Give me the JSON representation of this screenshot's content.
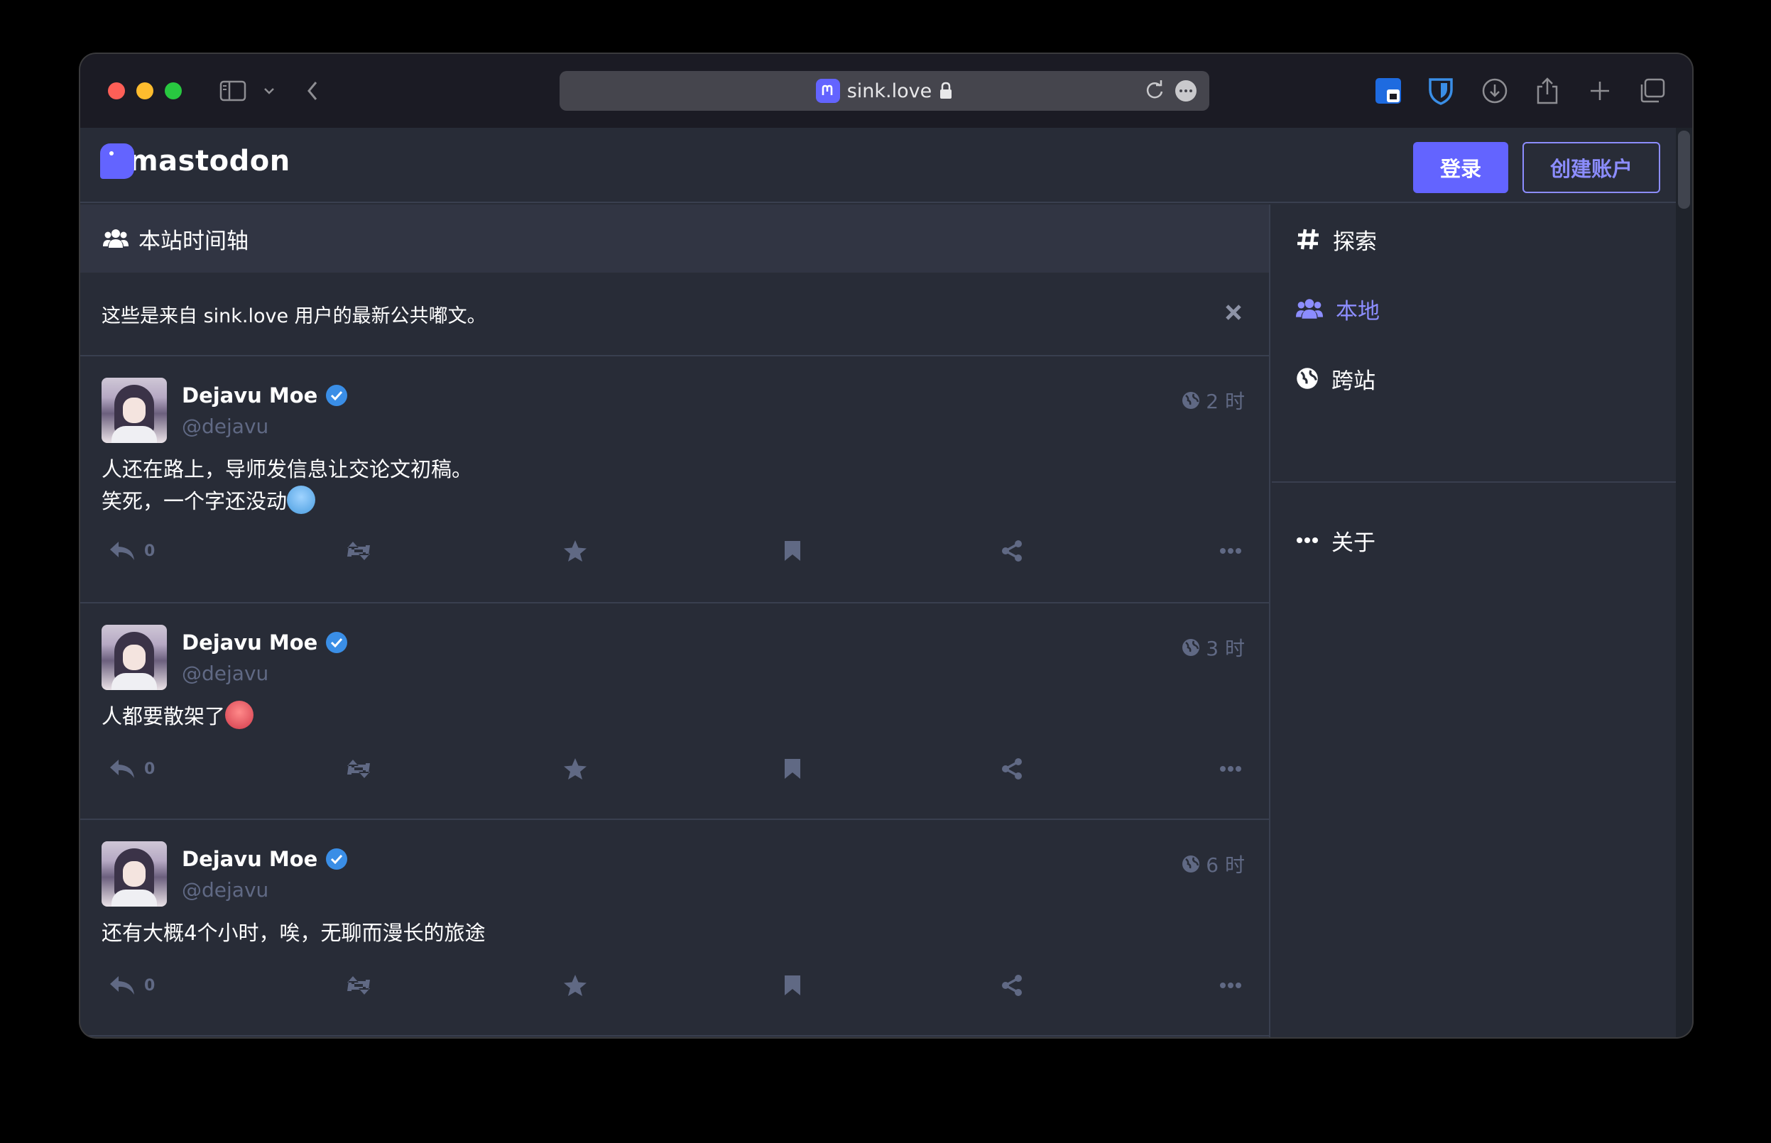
{
  "browser": {
    "url": "sink.love"
  },
  "header": {
    "logo_text": "mastodon",
    "login_label": "登录",
    "signup_label": "创建账户"
  },
  "timeline": {
    "title": "本站时间轴",
    "notice": "这些是来自 sink.love 用户的最新公共嘟文。"
  },
  "statuses": [
    {
      "display_name": "Dejavu Moe",
      "handle": "@dejavu",
      "time": "2 时",
      "lines": [
        "人还在路上，导师发信息让交论文初稿。",
        "笑死，一个字还没动"
      ],
      "emoji": "cold-face",
      "reply_count": "0"
    },
    {
      "display_name": "Dejavu Moe",
      "handle": "@dejavu",
      "time": "3 时",
      "lines": [
        "人都要散架了"
      ],
      "emoji": "hot-face",
      "reply_count": "0"
    },
    {
      "display_name": "Dejavu Moe",
      "handle": "@dejavu",
      "time": "6 时",
      "lines": [
        "还有大概4个小时，唉，无聊而漫长的旅途"
      ],
      "emoji": "",
      "reply_count": "0"
    }
  ],
  "sidebar": {
    "items": [
      {
        "label": "探索",
        "icon": "hashtag-icon",
        "active": false
      },
      {
        "label": "本地",
        "icon": "users-icon",
        "active": true
      },
      {
        "label": "跨站",
        "icon": "globe-icon",
        "active": false
      },
      {
        "label": "关于",
        "icon": "ellipsis-icon",
        "active": false
      }
    ]
  },
  "colors": {
    "accent": "#6364ff",
    "accent_text": "#8c8dff",
    "background": "#282c37",
    "muted": "#606984"
  }
}
